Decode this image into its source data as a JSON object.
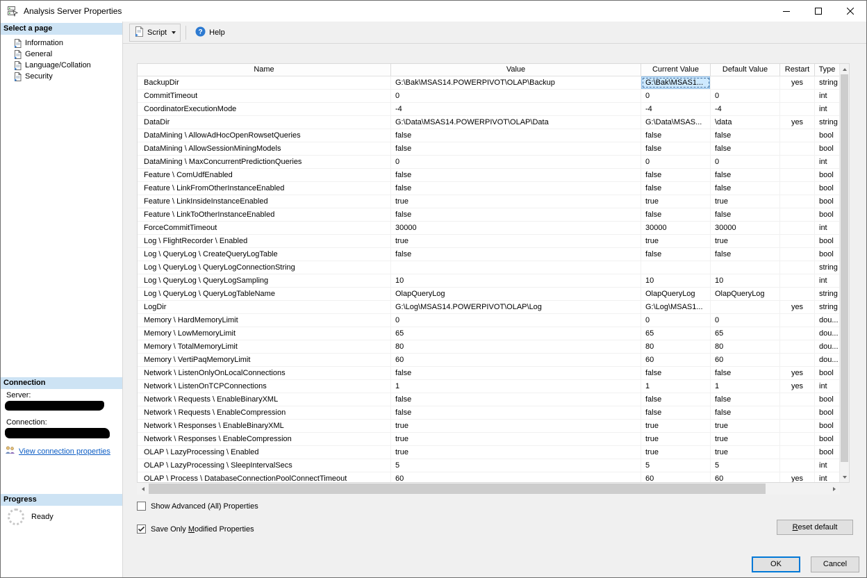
{
  "window": {
    "title": "Analysis Server Properties"
  },
  "sidebar": {
    "select_page": {
      "header": "Select a page",
      "pages": [
        {
          "label": "Information"
        },
        {
          "label": "General"
        },
        {
          "label": "Language/Collation"
        },
        {
          "label": "Security"
        }
      ]
    },
    "connection": {
      "header": "Connection",
      "server_label": "Server:",
      "connection_label": "Connection:",
      "view_link": "View connection properties"
    },
    "progress": {
      "header": "Progress",
      "status": "Ready"
    }
  },
  "toolbar": {
    "script_label": "Script",
    "help_label": "Help"
  },
  "grid": {
    "columns": [
      "Name",
      "Value",
      "Current Value",
      "Default Value",
      "Restart",
      "Type"
    ],
    "rows": [
      {
        "name": "BackupDir",
        "value": "G:\\Bak\\MSAS14.POWERPIVOT\\OLAP\\Backup",
        "current": "G:\\Bak\\MSAS1...",
        "default": "",
        "restart": "yes",
        "type": "string",
        "selected": true
      },
      {
        "name": "CommitTimeout",
        "value": "0",
        "current": "0",
        "default": "0",
        "restart": "",
        "type": "int"
      },
      {
        "name": "CoordinatorExecutionMode",
        "value": "-4",
        "current": "-4",
        "default": "-4",
        "restart": "",
        "type": "int"
      },
      {
        "name": "DataDir",
        "value": "G:\\Data\\MSAS14.POWERPIVOT\\OLAP\\Data",
        "current": "G:\\Data\\MSAS...",
        "default": "\\data",
        "restart": "yes",
        "type": "string"
      },
      {
        "name": "DataMining \\ AllowAdHocOpenRowsetQueries",
        "value": "false",
        "current": "false",
        "default": "false",
        "restart": "",
        "type": "bool"
      },
      {
        "name": "DataMining \\ AllowSessionMiningModels",
        "value": "false",
        "current": "false",
        "default": "false",
        "restart": "",
        "type": "bool"
      },
      {
        "name": "DataMining \\ MaxConcurrentPredictionQueries",
        "value": "0",
        "current": "0",
        "default": "0",
        "restart": "",
        "type": "int"
      },
      {
        "name": "Feature \\ ComUdfEnabled",
        "value": "false",
        "current": "false",
        "default": "false",
        "restart": "",
        "type": "bool"
      },
      {
        "name": "Feature \\ LinkFromOtherInstanceEnabled",
        "value": "false",
        "current": "false",
        "default": "false",
        "restart": "",
        "type": "bool"
      },
      {
        "name": "Feature \\ LinkInsideInstanceEnabled",
        "value": "true",
        "current": "true",
        "default": "true",
        "restart": "",
        "type": "bool"
      },
      {
        "name": "Feature \\ LinkToOtherInstanceEnabled",
        "value": "false",
        "current": "false",
        "default": "false",
        "restart": "",
        "type": "bool"
      },
      {
        "name": "ForceCommitTimeout",
        "value": "30000",
        "current": "30000",
        "default": "30000",
        "restart": "",
        "type": "int"
      },
      {
        "name": "Log \\ FlightRecorder \\ Enabled",
        "value": "true",
        "current": "true",
        "default": "true",
        "restart": "",
        "type": "bool"
      },
      {
        "name": "Log \\ QueryLog \\ CreateQueryLogTable",
        "value": "false",
        "current": "false",
        "default": "false",
        "restart": "",
        "type": "bool"
      },
      {
        "name": "Log \\ QueryLog \\ QueryLogConnectionString",
        "value": "",
        "current": "",
        "default": "",
        "restart": "",
        "type": "string"
      },
      {
        "name": "Log \\ QueryLog \\ QueryLogSampling",
        "value": "10",
        "current": "10",
        "default": "10",
        "restart": "",
        "type": "int"
      },
      {
        "name": "Log \\ QueryLog \\ QueryLogTableName",
        "value": "OlapQueryLog",
        "current": "OlapQueryLog",
        "default": "OlapQueryLog",
        "restart": "",
        "type": "string"
      },
      {
        "name": "LogDir",
        "value": "G:\\Log\\MSAS14.POWERPIVOT\\OLAP\\Log",
        "current": "G:\\Log\\MSAS1...",
        "default": "",
        "restart": "yes",
        "type": "string"
      },
      {
        "name": "Memory \\ HardMemoryLimit",
        "value": "0",
        "current": "0",
        "default": "0",
        "restart": "",
        "type": "dou..."
      },
      {
        "name": "Memory \\ LowMemoryLimit",
        "value": "65",
        "current": "65",
        "default": "65",
        "restart": "",
        "type": "dou..."
      },
      {
        "name": "Memory \\ TotalMemoryLimit",
        "value": "80",
        "current": "80",
        "default": "80",
        "restart": "",
        "type": "dou..."
      },
      {
        "name": "Memory \\ VertiPaqMemoryLimit",
        "value": "60",
        "current": "60",
        "default": "60",
        "restart": "",
        "type": "dou..."
      },
      {
        "name": "Network \\ ListenOnlyOnLocalConnections",
        "value": "false",
        "current": "false",
        "default": "false",
        "restart": "yes",
        "type": "bool"
      },
      {
        "name": "Network \\ ListenOnTCPConnections",
        "value": "1",
        "current": "1",
        "default": "1",
        "restart": "yes",
        "type": "int"
      },
      {
        "name": "Network \\ Requests \\ EnableBinaryXML",
        "value": "false",
        "current": "false",
        "default": "false",
        "restart": "",
        "type": "bool"
      },
      {
        "name": "Network \\ Requests \\ EnableCompression",
        "value": "false",
        "current": "false",
        "default": "false",
        "restart": "",
        "type": "bool"
      },
      {
        "name": "Network \\ Responses \\ EnableBinaryXML",
        "value": "true",
        "current": "true",
        "default": "true",
        "restart": "",
        "type": "bool"
      },
      {
        "name": "Network \\ Responses \\ EnableCompression",
        "value": "true",
        "current": "true",
        "default": "true",
        "restart": "",
        "type": "bool"
      },
      {
        "name": "OLAP \\ LazyProcessing \\ Enabled",
        "value": "true",
        "current": "true",
        "default": "true",
        "restart": "",
        "type": "bool"
      },
      {
        "name": "OLAP \\ LazyProcessing \\ SleepIntervalSecs",
        "value": "5",
        "current": "5",
        "default": "5",
        "restart": "",
        "type": "int"
      },
      {
        "name": "OLAP \\ Process \\ DatabaseConnectionPoolConnectTimeout",
        "value": "60",
        "current": "60",
        "default": "60",
        "restart": "yes",
        "type": "int"
      }
    ]
  },
  "footer": {
    "show_advanced": "Show Advanced (All) Properties",
    "save_modified": {
      "pre": "Save Only ",
      "accel": "M",
      "post": "odified Properties"
    },
    "reset_default": {
      "pre": "",
      "accel": "R",
      "post": "eset default"
    },
    "ok": "OK",
    "cancel": "Cancel"
  },
  "colors": {
    "accent": "#0078d7",
    "section_header_blue": "#cde3f4",
    "link_blue": "#0b5cc4",
    "selected_cell_bg": "#cde9ff"
  }
}
